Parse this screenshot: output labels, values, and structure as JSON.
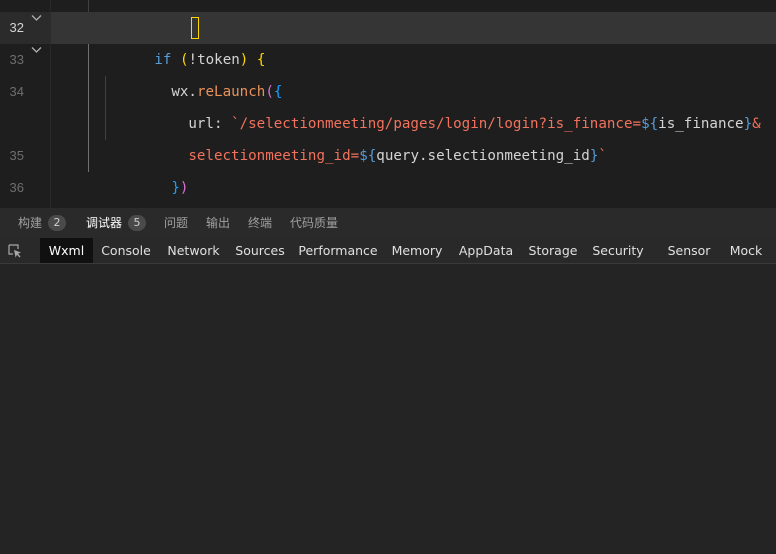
{
  "editor": {
    "lines": [
      {
        "num": "32",
        "tokens": [
          [
            "kw2",
            "if"
          ],
          [
            "",
            "  "
          ],
          [
            "par",
            "("
          ],
          [
            "",
            "!token"
          ],
          [
            "par",
            ")"
          ],
          [
            "",
            " "
          ],
          [
            "par",
            "{"
          ]
        ]
      },
      {
        "num": "33",
        "tokens": [
          [
            "",
            "wx."
          ],
          [
            "fn",
            "reLaunch"
          ],
          [
            "par2",
            "("
          ],
          [
            "par3",
            "{"
          ]
        ]
      },
      {
        "num": "34",
        "tokens": [
          [
            "",
            "url: "
          ],
          [
            "str",
            "`/selectionmeeting/pages/login/login?is_finance="
          ],
          [
            "kw2",
            "${"
          ],
          [
            "",
            "is_finance"
          ],
          [
            "kw2",
            "}"
          ],
          [
            "str",
            "&"
          ]
        ]
      },
      {
        "num": "",
        "tokens": [
          [
            "str",
            "selectionmeeting_id="
          ],
          [
            "kw2",
            "${"
          ],
          [
            "",
            "query.selectionmeeting_id"
          ],
          [
            "kw2",
            "}"
          ],
          [
            "str",
            "`"
          ]
        ]
      },
      {
        "num": "35",
        "tokens": [
          [
            "par3",
            "}"
          ],
          [
            "par2",
            ")"
          ]
        ]
      },
      {
        "num": "36",
        "tokens": [
          [
            "par",
            "}"
          ]
        ]
      }
    ]
  },
  "panel": {
    "tabs": [
      {
        "label": "构建",
        "badge": "2"
      },
      {
        "label": "调试器",
        "badge": "5"
      },
      {
        "label": "问题",
        "badge": ""
      },
      {
        "label": "输出",
        "badge": ""
      },
      {
        "label": "终端",
        "badge": ""
      },
      {
        "label": "代码质量",
        "badge": ""
      }
    ],
    "active": "调试器"
  },
  "devtools": {
    "tabs": [
      "Wxml",
      "Console",
      "Network",
      "Sources",
      "Performance",
      "Memory",
      "AppData",
      "Storage",
      "Security",
      "Sensor",
      "Mock"
    ],
    "active": "Wxml"
  },
  "icons": {
    "fold": "chevron-down-icon",
    "inspect": "inspect-element-icon"
  }
}
